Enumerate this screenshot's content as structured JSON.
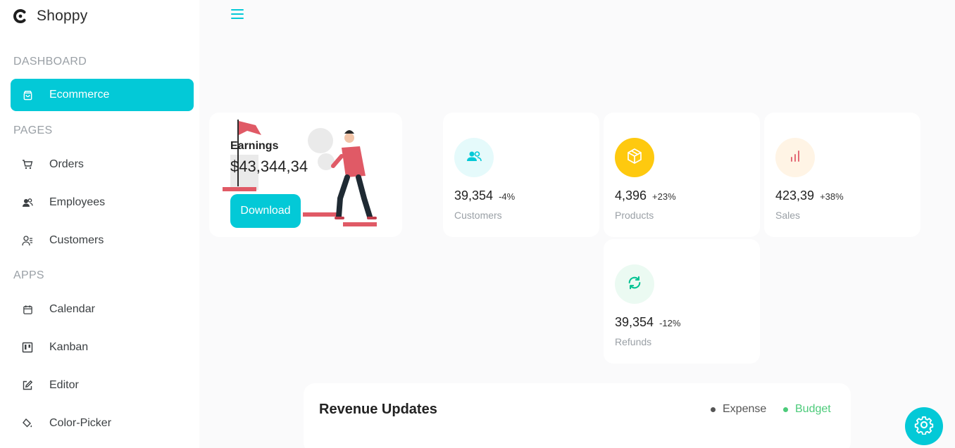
{
  "brand": {
    "name": "Shoppy",
    "icon": "shoppy-logo-icon"
  },
  "sidebar": {
    "sections": [
      {
        "title": "DASHBOARD"
      },
      {
        "title": "PAGES"
      },
      {
        "title": "APPS"
      }
    ],
    "items": [
      {
        "label": "Ecommerce",
        "icon": "shopping-bag-icon",
        "active": true
      },
      {
        "label": "Orders",
        "icon": "cart-icon"
      },
      {
        "label": "Employees",
        "icon": "employees-icon"
      },
      {
        "label": "Customers",
        "icon": "customers-icon"
      },
      {
        "label": "Calendar",
        "icon": "calendar-icon"
      },
      {
        "label": "Kanban",
        "icon": "kanban-icon"
      },
      {
        "label": "Editor",
        "icon": "edit-icon"
      },
      {
        "label": "Color-Picker",
        "icon": "color-picker-icon"
      }
    ]
  },
  "earnings": {
    "label": "Earnings",
    "value": "$43,344,34",
    "button": "Download"
  },
  "stats": [
    {
      "amount": "39,354",
      "percent": "-4%",
      "label": "Customers",
      "icon": "customers-icon",
      "icon_color": "#03c9d7",
      "icon_bg": "#e5fafb"
    },
    {
      "amount": "4,396",
      "percent": "+23%",
      "label": "Products",
      "icon": "box-icon",
      "icon_color": "#ffffff",
      "icon_bg": "#fec90f"
    },
    {
      "amount": "423,39",
      "percent": "+38%",
      "label": "Sales",
      "icon": "bar-chart-icon",
      "icon_color": "#e46a76",
      "icon_bg": "#fff4e5"
    },
    {
      "amount": "39,354",
      "percent": "-12%",
      "label": "Refunds",
      "icon": "refresh-icon",
      "icon_color": "#00c292",
      "icon_bg": "#ebfaf2"
    }
  ],
  "revenue": {
    "title": "Revenue Updates",
    "legend": [
      {
        "label": "Expense",
        "color": "#555555"
      },
      {
        "label": "Budget",
        "color": "#4ccb7a"
      }
    ]
  },
  "colors": {
    "accent": "#03c9d7"
  }
}
